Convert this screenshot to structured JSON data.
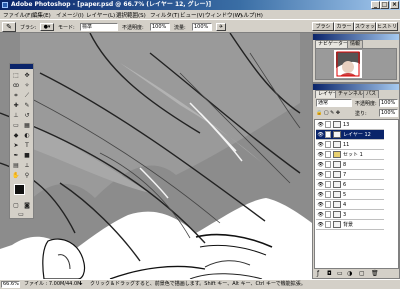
{
  "window": {
    "title": "Adobe Photoshop - [paper.psd @ 66.7% (レイヤー 12, グレー)]",
    "minimize": "_",
    "maximize": "□",
    "close": "×"
  },
  "menu": [
    "ファイル(F)",
    "編集(E)",
    "イメージ(I)",
    "レイヤー(L)",
    "選択範囲(S)",
    "フィルタ(T)",
    "ビュー(V)",
    "ウィンドウ(W)",
    "ヘルプ(H)"
  ],
  "options": {
    "brush_label": "ブラシ:",
    "mode_label": "モード:",
    "mode_value": "標準",
    "opacity_label": "不透明度:",
    "opacity_value": "100%",
    "flow_label": "流量:",
    "flow_value": "100%",
    "palette_well": [
      "ブラシ",
      "カラー",
      "スウォッチ",
      "ヒストリー"
    ]
  },
  "navigator": {
    "tabs": [
      "ナビゲーター",
      "情報"
    ]
  },
  "layers": {
    "tabs": [
      "レイヤー",
      "チャンネル",
      "パス"
    ],
    "mode": "通常",
    "opacity_label": "不透明度:",
    "opacity_value": "100%",
    "fill_label": "塗り:",
    "fill_value": "100%",
    "rows": [
      {
        "name": "13"
      },
      {
        "name": "レイヤー 12"
      },
      {
        "name": "11"
      },
      {
        "name": "セット 1"
      },
      {
        "name": "8"
      },
      {
        "name": "7"
      },
      {
        "name": "6"
      },
      {
        "name": "5"
      },
      {
        "name": "4"
      },
      {
        "name": "3"
      },
      {
        "name": "背景"
      }
    ]
  },
  "status": {
    "zoom": "66.6%",
    "file": "ファイル : 7.00M/44.0M",
    "hint": "クリック＆ドラッグすると、前景色で描画します。Shift キー、Alt キー、Ctrl キーで機能拡張。"
  }
}
